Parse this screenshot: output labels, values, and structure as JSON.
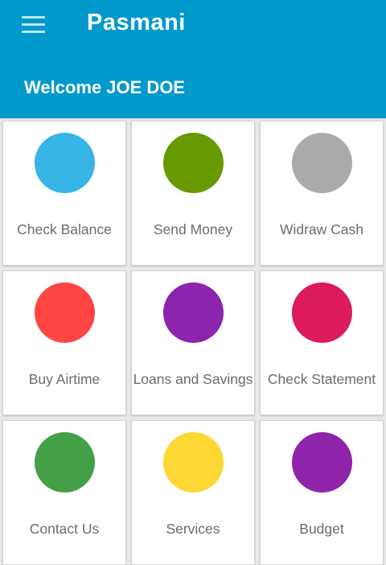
{
  "app": {
    "title": "Pasmani",
    "welcome": "Welcome JOE DOE",
    "header_color": "#0299cc"
  },
  "menu": {
    "icon": "hamburger-menu-icon"
  },
  "tiles": [
    {
      "label": "Check Balance",
      "color": "#36b5e6"
    },
    {
      "label": "Send Money",
      "color": "#669a00"
    },
    {
      "label": "Widraw Cash",
      "color": "#aaaaaa"
    },
    {
      "label": "Buy Airtime",
      "color": "#ff4444"
    },
    {
      "label": "Loans and Savings",
      "color": "#8d24ad"
    },
    {
      "label": "Check Statement",
      "color": "#dc1a5e"
    },
    {
      "label": "Contact Us",
      "color": "#43a047"
    },
    {
      "label": "Services",
      "color": "#fdd835"
    },
    {
      "label": "Budget",
      "color": "#8e24aa"
    }
  ]
}
